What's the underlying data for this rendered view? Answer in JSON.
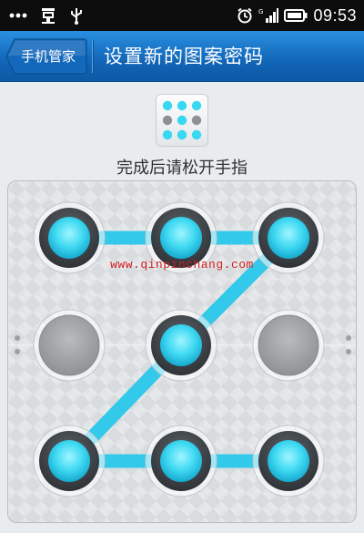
{
  "status_bar": {
    "time": "09:53",
    "left_icons": [
      "more-icon",
      "usb-debug-icon",
      "usb-icon"
    ],
    "right_icons": [
      "alarm-icon",
      "signal-icon",
      "battery-icon"
    ]
  },
  "header": {
    "back_label": "手机管家",
    "title": "设置新的图案密码"
  },
  "hint": "完成后请松开手指",
  "watermark": "www.qinpinchang.com",
  "pattern": {
    "rows": 3,
    "cols": 3,
    "selected": [
      1,
      2,
      3,
      5,
      7,
      8,
      9
    ],
    "sequence": [
      1,
      2,
      3,
      5,
      7,
      8,
      9
    ]
  },
  "colors": {
    "header": "#1a73c9",
    "active_dot": "#39d8f2",
    "line": "#33c9ea",
    "inactive_dot": "#a5a8ab"
  }
}
